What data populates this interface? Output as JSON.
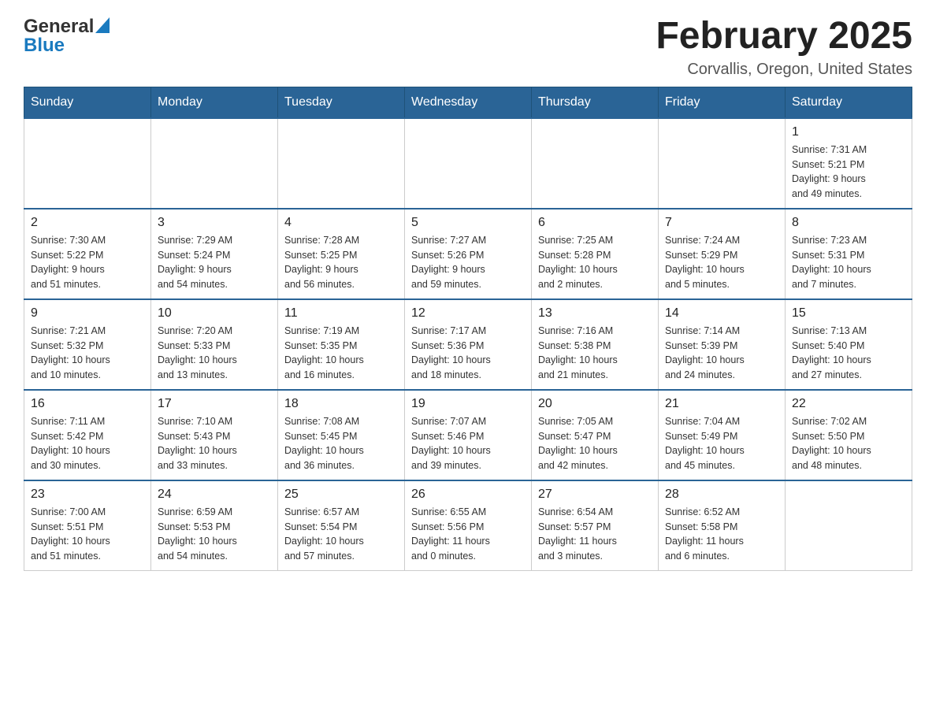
{
  "header": {
    "logo": {
      "general": "General",
      "blue": "Blue"
    },
    "title": "February 2025",
    "subtitle": "Corvallis, Oregon, United States"
  },
  "days_of_week": [
    "Sunday",
    "Monday",
    "Tuesday",
    "Wednesday",
    "Thursday",
    "Friday",
    "Saturday"
  ],
  "weeks": [
    [
      {
        "day": "",
        "info": ""
      },
      {
        "day": "",
        "info": ""
      },
      {
        "day": "",
        "info": ""
      },
      {
        "day": "",
        "info": ""
      },
      {
        "day": "",
        "info": ""
      },
      {
        "day": "",
        "info": ""
      },
      {
        "day": "1",
        "info": "Sunrise: 7:31 AM\nSunset: 5:21 PM\nDaylight: 9 hours\nand 49 minutes."
      }
    ],
    [
      {
        "day": "2",
        "info": "Sunrise: 7:30 AM\nSunset: 5:22 PM\nDaylight: 9 hours\nand 51 minutes."
      },
      {
        "day": "3",
        "info": "Sunrise: 7:29 AM\nSunset: 5:24 PM\nDaylight: 9 hours\nand 54 minutes."
      },
      {
        "day": "4",
        "info": "Sunrise: 7:28 AM\nSunset: 5:25 PM\nDaylight: 9 hours\nand 56 minutes."
      },
      {
        "day": "5",
        "info": "Sunrise: 7:27 AM\nSunset: 5:26 PM\nDaylight: 9 hours\nand 59 minutes."
      },
      {
        "day": "6",
        "info": "Sunrise: 7:25 AM\nSunset: 5:28 PM\nDaylight: 10 hours\nand 2 minutes."
      },
      {
        "day": "7",
        "info": "Sunrise: 7:24 AM\nSunset: 5:29 PM\nDaylight: 10 hours\nand 5 minutes."
      },
      {
        "day": "8",
        "info": "Sunrise: 7:23 AM\nSunset: 5:31 PM\nDaylight: 10 hours\nand 7 minutes."
      }
    ],
    [
      {
        "day": "9",
        "info": "Sunrise: 7:21 AM\nSunset: 5:32 PM\nDaylight: 10 hours\nand 10 minutes."
      },
      {
        "day": "10",
        "info": "Sunrise: 7:20 AM\nSunset: 5:33 PM\nDaylight: 10 hours\nand 13 minutes."
      },
      {
        "day": "11",
        "info": "Sunrise: 7:19 AM\nSunset: 5:35 PM\nDaylight: 10 hours\nand 16 minutes."
      },
      {
        "day": "12",
        "info": "Sunrise: 7:17 AM\nSunset: 5:36 PM\nDaylight: 10 hours\nand 18 minutes."
      },
      {
        "day": "13",
        "info": "Sunrise: 7:16 AM\nSunset: 5:38 PM\nDaylight: 10 hours\nand 21 minutes."
      },
      {
        "day": "14",
        "info": "Sunrise: 7:14 AM\nSunset: 5:39 PM\nDaylight: 10 hours\nand 24 minutes."
      },
      {
        "day": "15",
        "info": "Sunrise: 7:13 AM\nSunset: 5:40 PM\nDaylight: 10 hours\nand 27 minutes."
      }
    ],
    [
      {
        "day": "16",
        "info": "Sunrise: 7:11 AM\nSunset: 5:42 PM\nDaylight: 10 hours\nand 30 minutes."
      },
      {
        "day": "17",
        "info": "Sunrise: 7:10 AM\nSunset: 5:43 PM\nDaylight: 10 hours\nand 33 minutes."
      },
      {
        "day": "18",
        "info": "Sunrise: 7:08 AM\nSunset: 5:45 PM\nDaylight: 10 hours\nand 36 minutes."
      },
      {
        "day": "19",
        "info": "Sunrise: 7:07 AM\nSunset: 5:46 PM\nDaylight: 10 hours\nand 39 minutes."
      },
      {
        "day": "20",
        "info": "Sunrise: 7:05 AM\nSunset: 5:47 PM\nDaylight: 10 hours\nand 42 minutes."
      },
      {
        "day": "21",
        "info": "Sunrise: 7:04 AM\nSunset: 5:49 PM\nDaylight: 10 hours\nand 45 minutes."
      },
      {
        "day": "22",
        "info": "Sunrise: 7:02 AM\nSunset: 5:50 PM\nDaylight: 10 hours\nand 48 minutes."
      }
    ],
    [
      {
        "day": "23",
        "info": "Sunrise: 7:00 AM\nSunset: 5:51 PM\nDaylight: 10 hours\nand 51 minutes."
      },
      {
        "day": "24",
        "info": "Sunrise: 6:59 AM\nSunset: 5:53 PM\nDaylight: 10 hours\nand 54 minutes."
      },
      {
        "day": "25",
        "info": "Sunrise: 6:57 AM\nSunset: 5:54 PM\nDaylight: 10 hours\nand 57 minutes."
      },
      {
        "day": "26",
        "info": "Sunrise: 6:55 AM\nSunset: 5:56 PM\nDaylight: 11 hours\nand 0 minutes."
      },
      {
        "day": "27",
        "info": "Sunrise: 6:54 AM\nSunset: 5:57 PM\nDaylight: 11 hours\nand 3 minutes."
      },
      {
        "day": "28",
        "info": "Sunrise: 6:52 AM\nSunset: 5:58 PM\nDaylight: 11 hours\nand 6 minutes."
      },
      {
        "day": "",
        "info": ""
      }
    ]
  ]
}
